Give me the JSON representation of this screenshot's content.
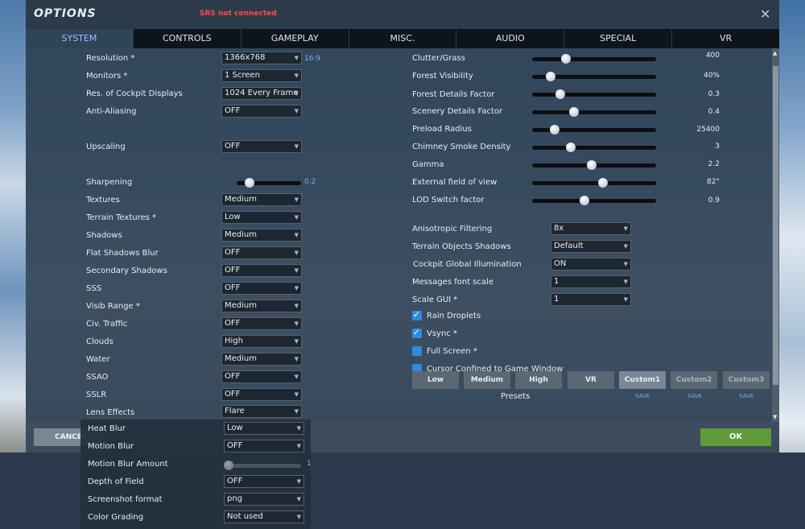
{
  "window": {
    "title": "OPTIONS",
    "srs_status": "SRS not connected",
    "close_glyph": "✕"
  },
  "tabs": [
    {
      "label": "SYSTEM",
      "active": true
    },
    {
      "label": "CONTROLS"
    },
    {
      "label": "GAMEPLAY"
    },
    {
      "label": "MISC."
    },
    {
      "label": "AUDIO"
    },
    {
      "label": "SPECIAL"
    },
    {
      "label": "VR"
    }
  ],
  "left": {
    "resolution": {
      "label": "Resolution *",
      "value": "1366x768",
      "aspect": "16:9"
    },
    "monitors": {
      "label": "Monitors *",
      "value": "1 Screen"
    },
    "cockpit_displays": {
      "label": "Res. of Cockpit Displays",
      "value": "1024 Every Frame"
    },
    "anti_aliasing": {
      "label": "Anti-Aliasing",
      "value": "OFF"
    },
    "upscaling": {
      "label": "Upscaling",
      "value": "OFF"
    },
    "sharpening": {
      "label": "Sharpening",
      "value": "0.2",
      "level": 0.2
    },
    "textures": {
      "label": "Textures",
      "value": "Medium"
    },
    "terrain_textures": {
      "label": "Terrain Textures *",
      "value": "Low"
    },
    "shadows": {
      "label": "Shadows",
      "value": "Medium"
    },
    "flat_shadows_blur": {
      "label": "Flat Shadows Blur",
      "value": "OFF"
    },
    "secondary_shadows": {
      "label": "Secondary Shadows",
      "value": "OFF"
    },
    "sss": {
      "label": "SSS",
      "value": "OFF"
    },
    "visib_range": {
      "label": "Visib Range *",
      "value": "Medium"
    },
    "civ_traffic": {
      "label": "Civ. Traffic",
      "value": "OFF"
    },
    "clouds": {
      "label": "Clouds",
      "value": "High"
    },
    "water": {
      "label": "Water",
      "value": "Medium"
    },
    "ssao": {
      "label": "SSAO",
      "value": "OFF"
    },
    "sslr": {
      "label": "SSLR",
      "value": "OFF"
    },
    "lens_effects": {
      "label": "Lens Effects",
      "value": "Flare"
    },
    "heat_blur": {
      "label": "Heat Blur",
      "value": "Low"
    },
    "motion_blur": {
      "label": "Motion Blur",
      "value": "OFF"
    },
    "motion_blur_amount": {
      "label": "Motion Blur Amount",
      "value": "1",
      "level": 0.0
    },
    "depth_of_field": {
      "label": "Depth of Field",
      "value": "OFF"
    },
    "screenshot_format": {
      "label": "Screenshot format",
      "value": "png"
    },
    "color_grading": {
      "label": "Color Grading",
      "value": "Not used"
    }
  },
  "right": {
    "clutter_grass": {
      "label": "Clutter/Grass",
      "value": "400",
      "level": 0.27
    },
    "forest_visibility": {
      "label": "Forest Visibility",
      "value": "40%",
      "level": 0.15
    },
    "forest_details": {
      "label": "Forest Details Factor",
      "value": "0.3",
      "level": 0.23
    },
    "scenery_details": {
      "label": "Scenery Details Factor",
      "value": "0.4",
      "level": 0.34
    },
    "preload_radius": {
      "label": "Preload Radius",
      "value": "25400",
      "level": 0.18
    },
    "chimney_smoke": {
      "label": "Chimney Smoke Density",
      "value": "3",
      "level": 0.31
    },
    "gamma": {
      "label": "Gamma",
      "value": "2.2",
      "level": 0.48
    },
    "external_fov": {
      "label": "External field of view",
      "value": "82°",
      "level": 0.57
    },
    "lod_switch": {
      "label": "LOD Switch factor",
      "value": "0.9",
      "level": 0.42
    },
    "anisotropic": {
      "label": "Anisotropic Filtering",
      "value": "8x"
    },
    "terrain_objects_shadows": {
      "label": "Terrain Objects Shadows",
      "value": "Default"
    },
    "cockpit_gi": {
      "label": "Cockpit Global Illumination",
      "value": "ON"
    },
    "messages_font_scale": {
      "label": "Messages font scale",
      "value": "1"
    },
    "scale_gui": {
      "label": "Scale GUI *",
      "value": "1"
    },
    "rain_droplets": {
      "label": "Rain Droplets",
      "checked": true
    },
    "vsync": {
      "label": "Vsync *",
      "checked": true
    },
    "full_screen": {
      "label": "Full Screen *",
      "checked": false
    },
    "cursor_confined": {
      "label": "Cursor Confined to Game Window",
      "checked": false
    }
  },
  "presets": {
    "title": "Presets",
    "items": [
      "Low",
      "Medium",
      "High",
      "VR",
      "Custom1",
      "Custom2",
      "Custom3"
    ],
    "save_label": "SAVE"
  },
  "buttons": {
    "cancel": "CANCEL",
    "ok": "OK"
  }
}
